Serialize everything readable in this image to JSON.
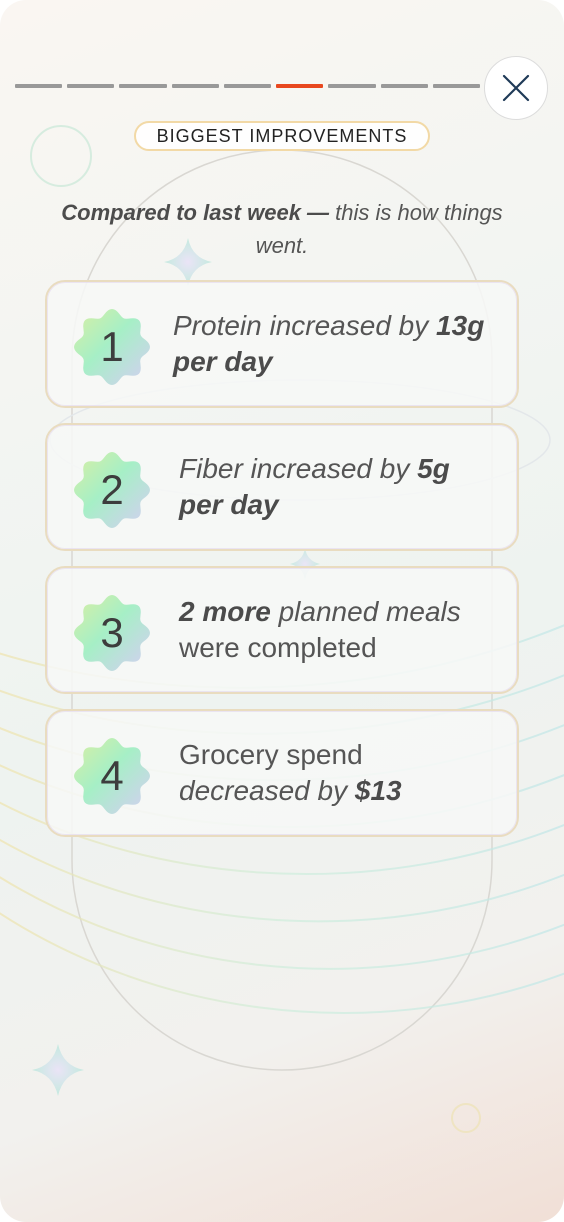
{
  "progress": {
    "segments": 9,
    "active_index": 5
  },
  "close": {
    "icon": "close-icon"
  },
  "header": {
    "badge": "BIGGEST IMPROVEMENTS"
  },
  "intro": {
    "bold": "Compared to last week —",
    "rest": " this is how things went."
  },
  "items": [
    {
      "number": "1",
      "parts": [
        {
          "t": "Protein increased by ",
          "s": "it"
        },
        {
          "t": "13g per day",
          "s": "bi"
        }
      ]
    },
    {
      "number": "2",
      "parts": [
        {
          "t": "Fiber increased by ",
          "s": "it"
        },
        {
          "t": "5g",
          "s": "bi"
        },
        {
          "t": " per day",
          "s": "bi"
        }
      ]
    },
    {
      "number": "3",
      "parts": [
        {
          "t": "2",
          "s": "bi"
        },
        {
          "t": " more",
          "s": "bi"
        },
        {
          "t": " planned meals",
          "s": "it"
        },
        {
          "t": " were completed",
          "s": "plain"
        }
      ]
    },
    {
      "number": "4",
      "parts": [
        {
          "t": "Grocery spend ",
          "s": "plain"
        },
        {
          "t": "decreased by ",
          "s": "it"
        },
        {
          "t": "$13",
          "s": "bi"
        }
      ]
    }
  ],
  "colors": {
    "accent": "#e8481f",
    "segment": "#999999",
    "badge_border": "#f2d9a6"
  }
}
